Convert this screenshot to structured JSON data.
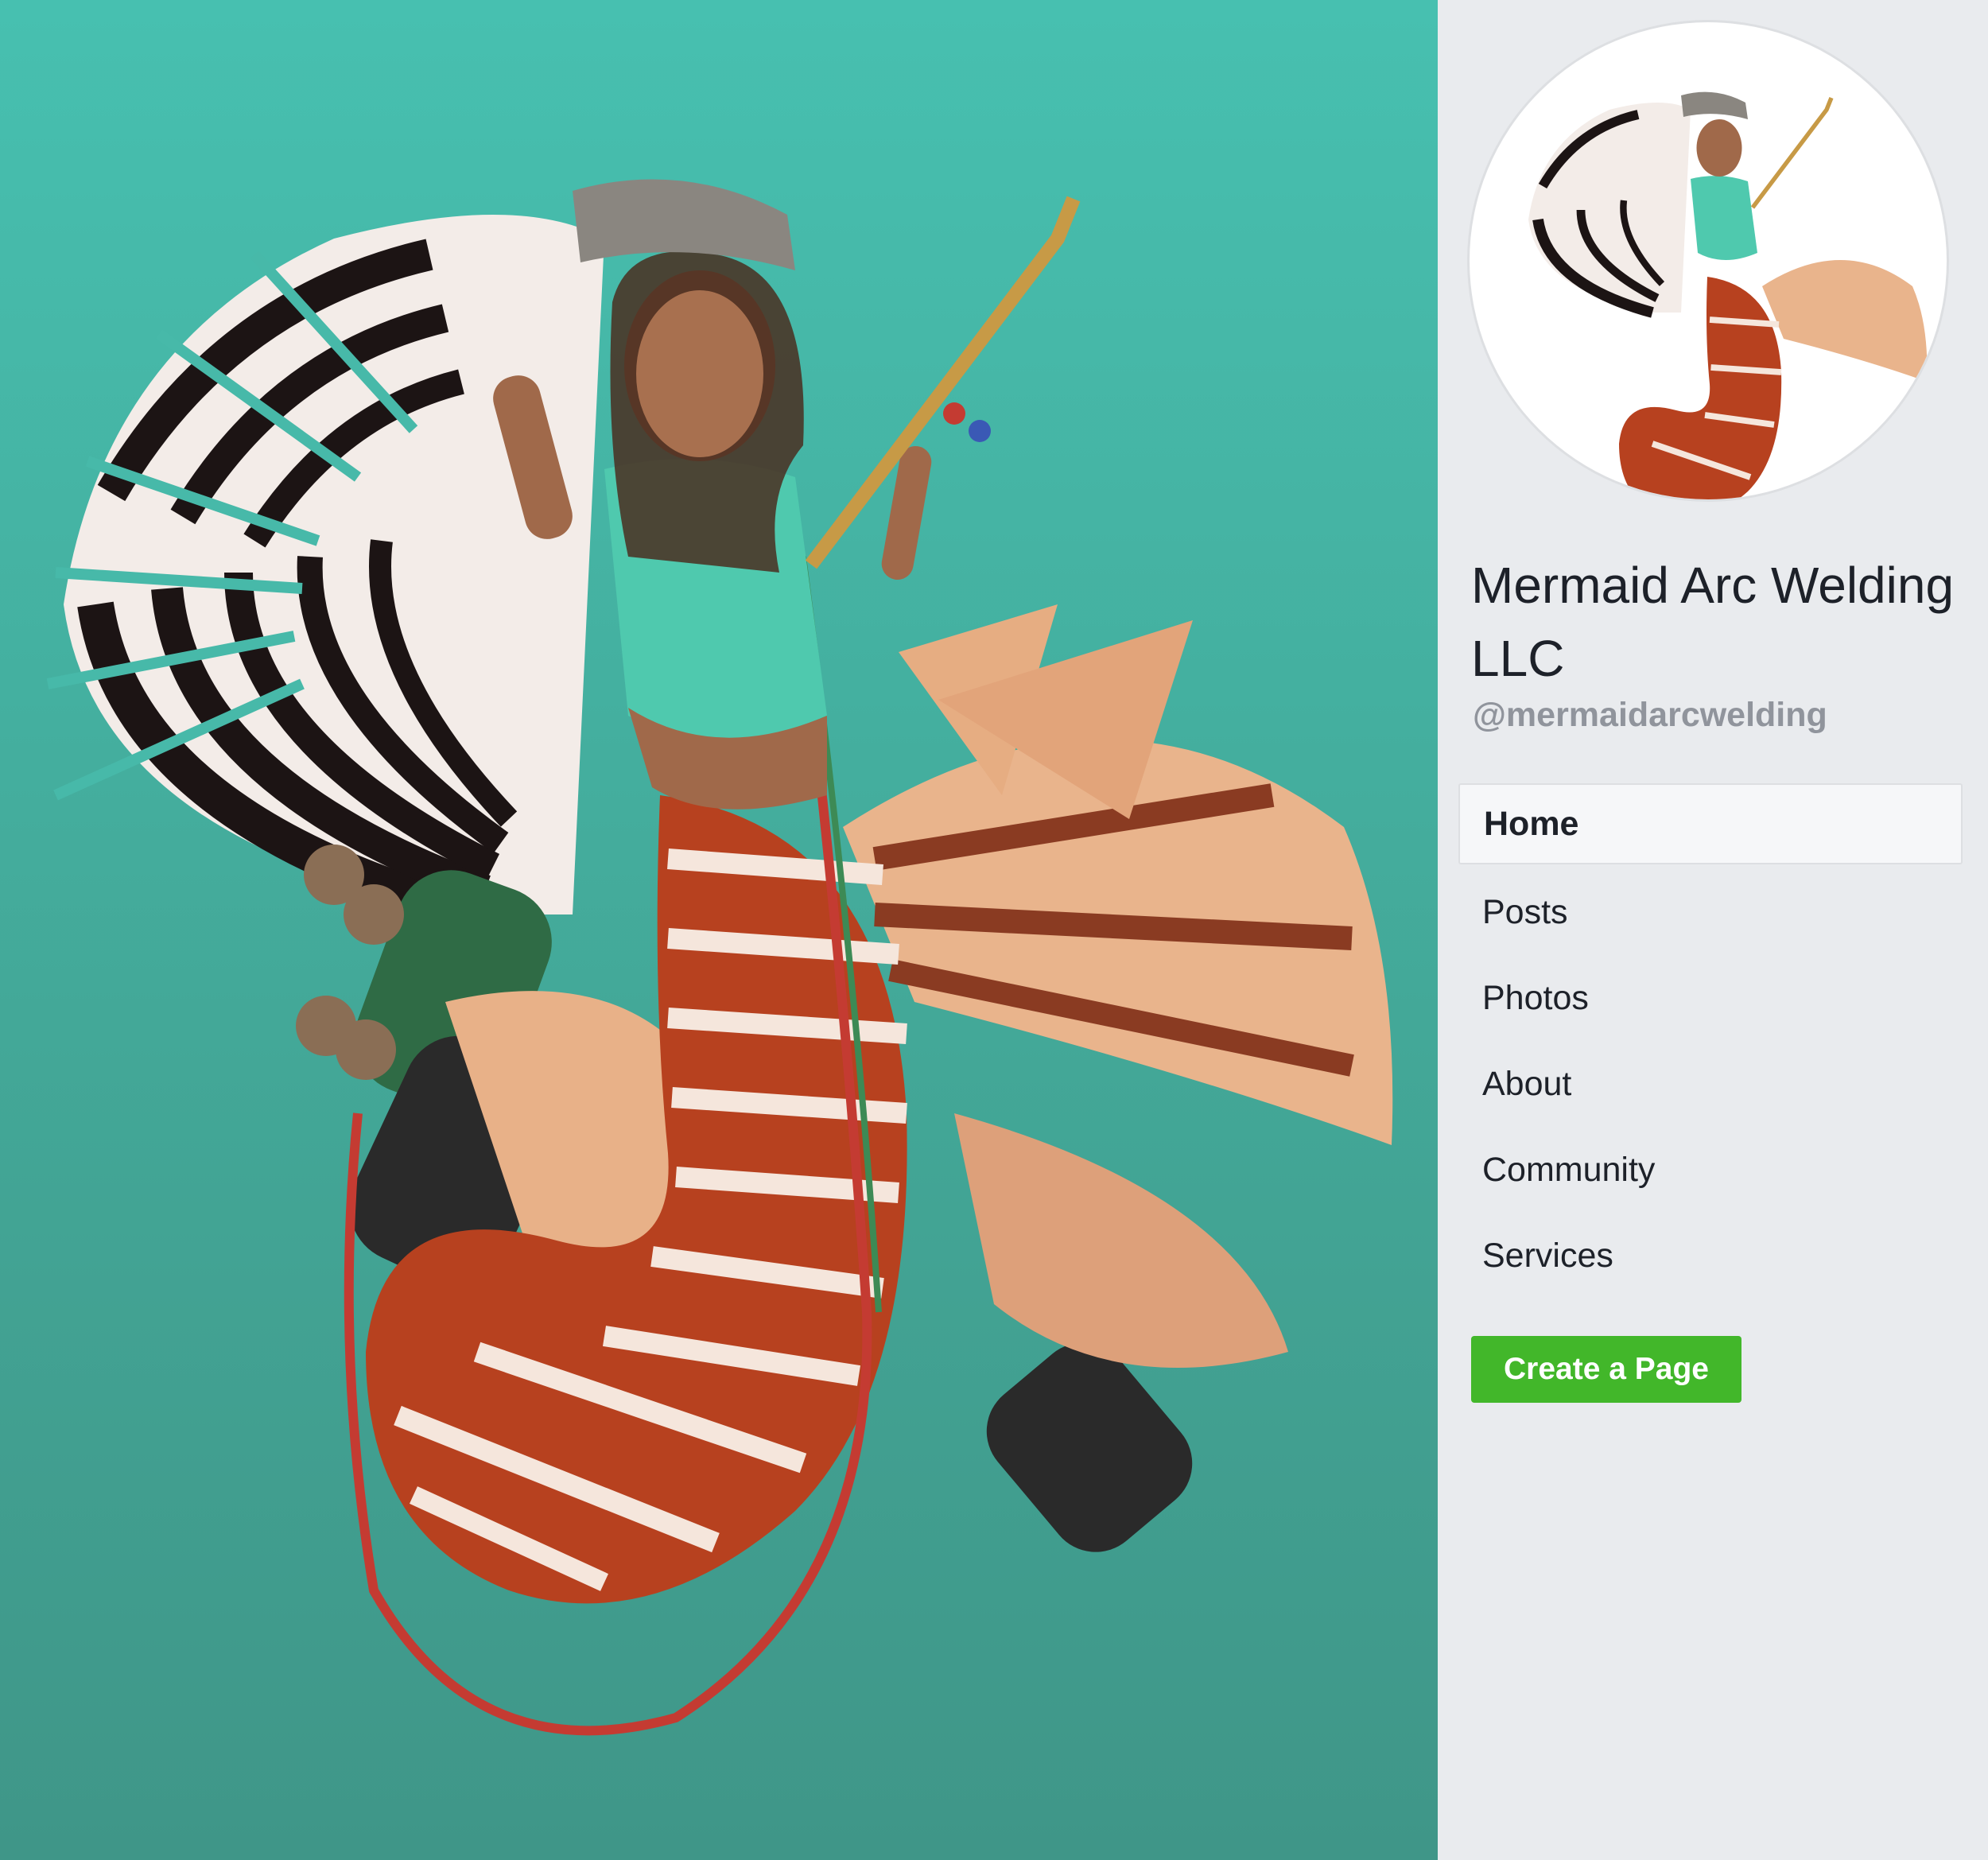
{
  "artwork": {
    "background_top": "#47c0b0",
    "background_bottom": "#3f9688",
    "image": "mermaid-welder-illustration"
  },
  "sidebar": {
    "profile_image": "mermaid-welder-avatar",
    "title": "Mermaid Arc Welding LLC",
    "handle": "@mermaidarcwelding",
    "nav": [
      {
        "label": "Home",
        "active": true
      },
      {
        "label": "Posts",
        "active": false
      },
      {
        "label": "Photos",
        "active": false
      },
      {
        "label": "About",
        "active": false
      },
      {
        "label": "Community",
        "active": false
      },
      {
        "label": "Services",
        "active": false
      }
    ],
    "create_page_label": "Create a Page",
    "accent_color": "#42b72a"
  }
}
